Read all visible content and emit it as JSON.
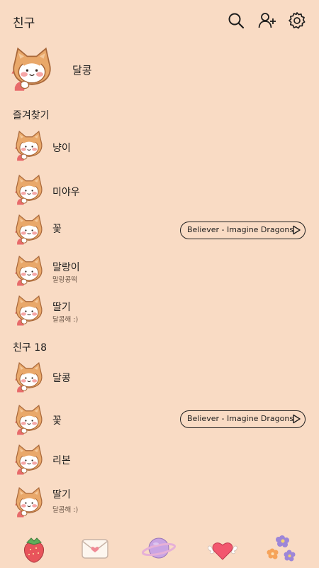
{
  "header": {
    "title": "친구",
    "icons": [
      "search-icon",
      "add-friend-icon",
      "settings-icon"
    ]
  },
  "me": {
    "name": "달콩"
  },
  "favorites": {
    "label": "즐겨찾기",
    "items": [
      {
        "name": "냥이",
        "status": ""
      },
      {
        "name": "미야우",
        "status": ""
      },
      {
        "name": "꽃",
        "status": "",
        "music": "Believer - Imagine Dragons"
      },
      {
        "name": "말랑이",
        "status": "말랑콩떡"
      },
      {
        "name": "딸기",
        "status": "달콤해 :)"
      }
    ]
  },
  "friends": {
    "label": "친구 18",
    "items": [
      {
        "name": "달콩",
        "status": ""
      },
      {
        "name": "꽃",
        "status": "",
        "music": "Believer - Imagine Dragons"
      },
      {
        "name": "리본",
        "status": ""
      },
      {
        "name": "딸기",
        "status": "달콤해 :)"
      }
    ]
  },
  "tabbar": {
    "icons": [
      "strawberry-icon",
      "envelope-icon",
      "planet-icon",
      "winged-heart-icon",
      "flowers-icon"
    ]
  },
  "colors": {
    "background": "#f9dbc4",
    "cat_hood": "#e9a86a",
    "text": "#1e1e1e"
  }
}
